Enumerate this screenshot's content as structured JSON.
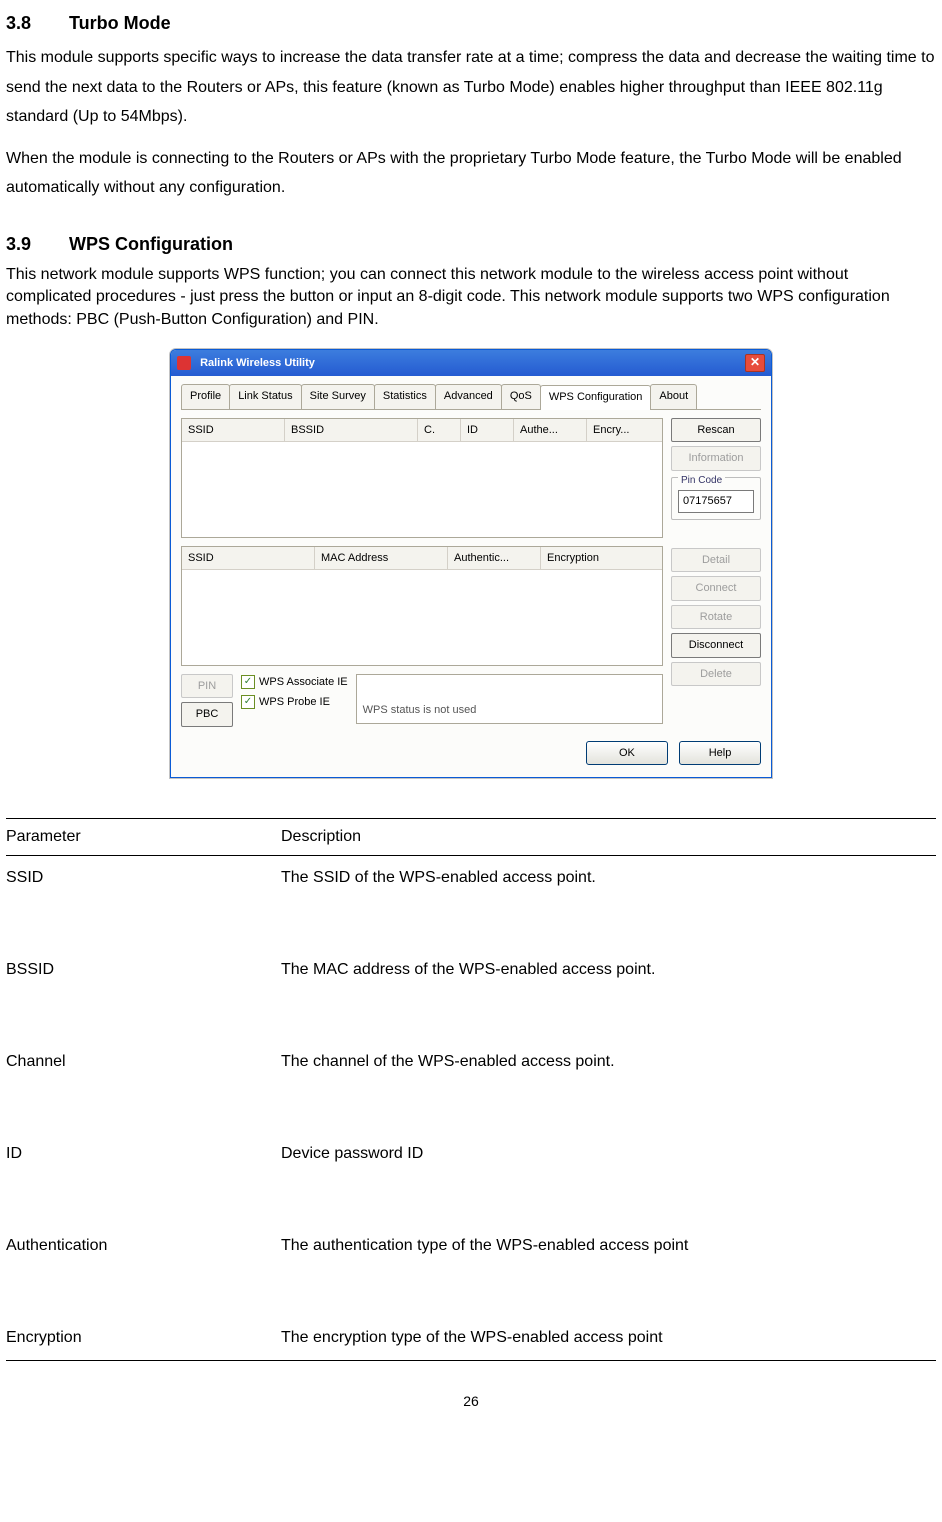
{
  "section38": {
    "num": "3.8",
    "title": "Turbo Mode",
    "p1": "This module supports specific ways to increase the data transfer rate at a time; compress the data and decrease the waiting time to send the next data to the Routers or APs, this feature (known as Turbo Mode) enables higher throughput than IEEE 802.11g standard (Up to 54Mbps).",
    "p2": "When the module is connecting to the Routers or APs with the proprietary Turbo Mode feature, the Turbo Mode will be enabled automatically without any configuration."
  },
  "section39": {
    "num": "3.9",
    "title": "WPS Configuration",
    "p1": "This network module supports WPS function; you can connect this network module to the wireless access point without complicated procedures - just press the button or input an 8-digit code. This network module supports two WPS configuration methods: PBC (Push-Button Configuration) and PIN."
  },
  "win": {
    "title": "Ralink Wireless Utility",
    "tabs": [
      "Profile",
      "Link Status",
      "Site Survey",
      "Statistics",
      "Advanced",
      "QoS",
      "WPS Configuration",
      "About"
    ],
    "grid1_headers": [
      "SSID",
      "BSSID",
      "C.",
      "ID",
      "Authe...",
      "Encry..."
    ],
    "grid2_headers": [
      "SSID",
      "MAC Address",
      "Authentic...",
      "Encryption"
    ],
    "side_buttons_top": [
      {
        "label": "Rescan",
        "disabled": false
      },
      {
        "label": "Information",
        "disabled": true
      }
    ],
    "pin_label": "Pin Code",
    "pin_value": "07175657",
    "side_buttons_bottom": [
      {
        "label": "Detail",
        "disabled": true
      },
      {
        "label": "Connect",
        "disabled": true
      },
      {
        "label": "Rotate",
        "disabled": true
      },
      {
        "label": "Disconnect",
        "disabled": false
      },
      {
        "label": "Delete",
        "disabled": true
      }
    ],
    "pin_btn": "PIN",
    "pbc_btn": "PBC",
    "chk1": "WPS Associate IE",
    "chk2": "WPS Probe IE",
    "status": "WPS status is not used",
    "ok": "OK",
    "help": "Help"
  },
  "ptable": {
    "hParam": "Parameter",
    "hDesc": "Description",
    "rows": [
      {
        "k": "SSID",
        "v": "The SSID of the WPS-enabled access point."
      },
      {
        "k": "BSSID",
        "v": "The MAC address of the WPS-enabled access point."
      },
      {
        "k": "Channel",
        "v": "The channel of the WPS-enabled access point."
      },
      {
        "k": "ID",
        "v": "Device password ID"
      },
      {
        "k": "Authentication",
        "v": "The authentication type of the WPS-enabled access point"
      },
      {
        "k": "Encryption",
        "v": "The encryption type of the WPS-enabled access point"
      }
    ]
  },
  "pagenum": "26"
}
